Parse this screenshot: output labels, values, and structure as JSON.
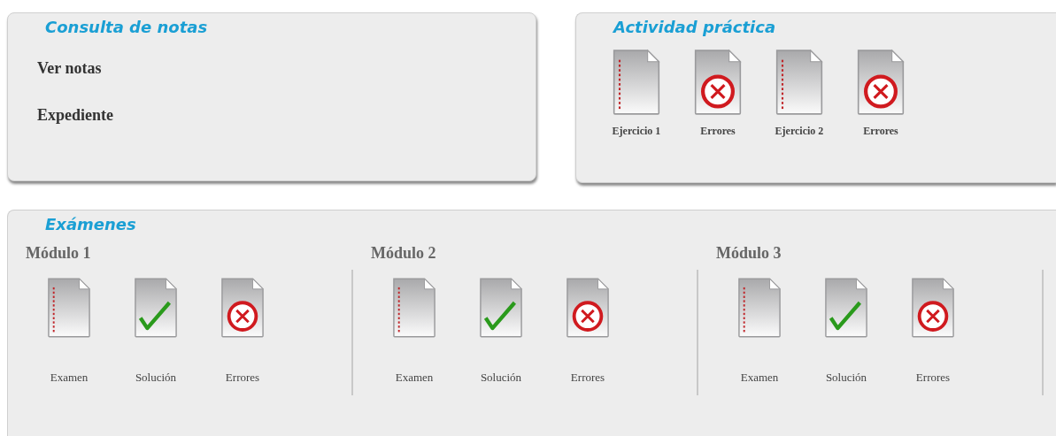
{
  "consulta": {
    "title": "Consulta de notas",
    "links": [
      "Ver notas",
      "Expediente"
    ]
  },
  "actividad": {
    "title": "Actividad práctica",
    "items": [
      {
        "kind": "document",
        "label": "Ejercicio 1"
      },
      {
        "kind": "error",
        "label": "Errores"
      },
      {
        "kind": "document",
        "label": "Ejercicio 2"
      },
      {
        "kind": "error",
        "label": "Errores"
      }
    ]
  },
  "examenes": {
    "title": "Exámenes",
    "modules": [
      {
        "title": "Módulo 1",
        "items": [
          {
            "kind": "document",
            "label": "Examen"
          },
          {
            "kind": "solution",
            "label": "Solución"
          },
          {
            "kind": "error",
            "label": "Errores"
          }
        ]
      },
      {
        "title": "Módulo 2",
        "items": [
          {
            "kind": "document",
            "label": "Examen"
          },
          {
            "kind": "solution",
            "label": "Solución"
          },
          {
            "kind": "error",
            "label": "Errores"
          }
        ]
      },
      {
        "title": "Módulo 3",
        "items": [
          {
            "kind": "document",
            "label": "Examen"
          },
          {
            "kind": "solution",
            "label": "Solución"
          },
          {
            "kind": "error",
            "label": "Errores"
          }
        ]
      }
    ]
  }
}
